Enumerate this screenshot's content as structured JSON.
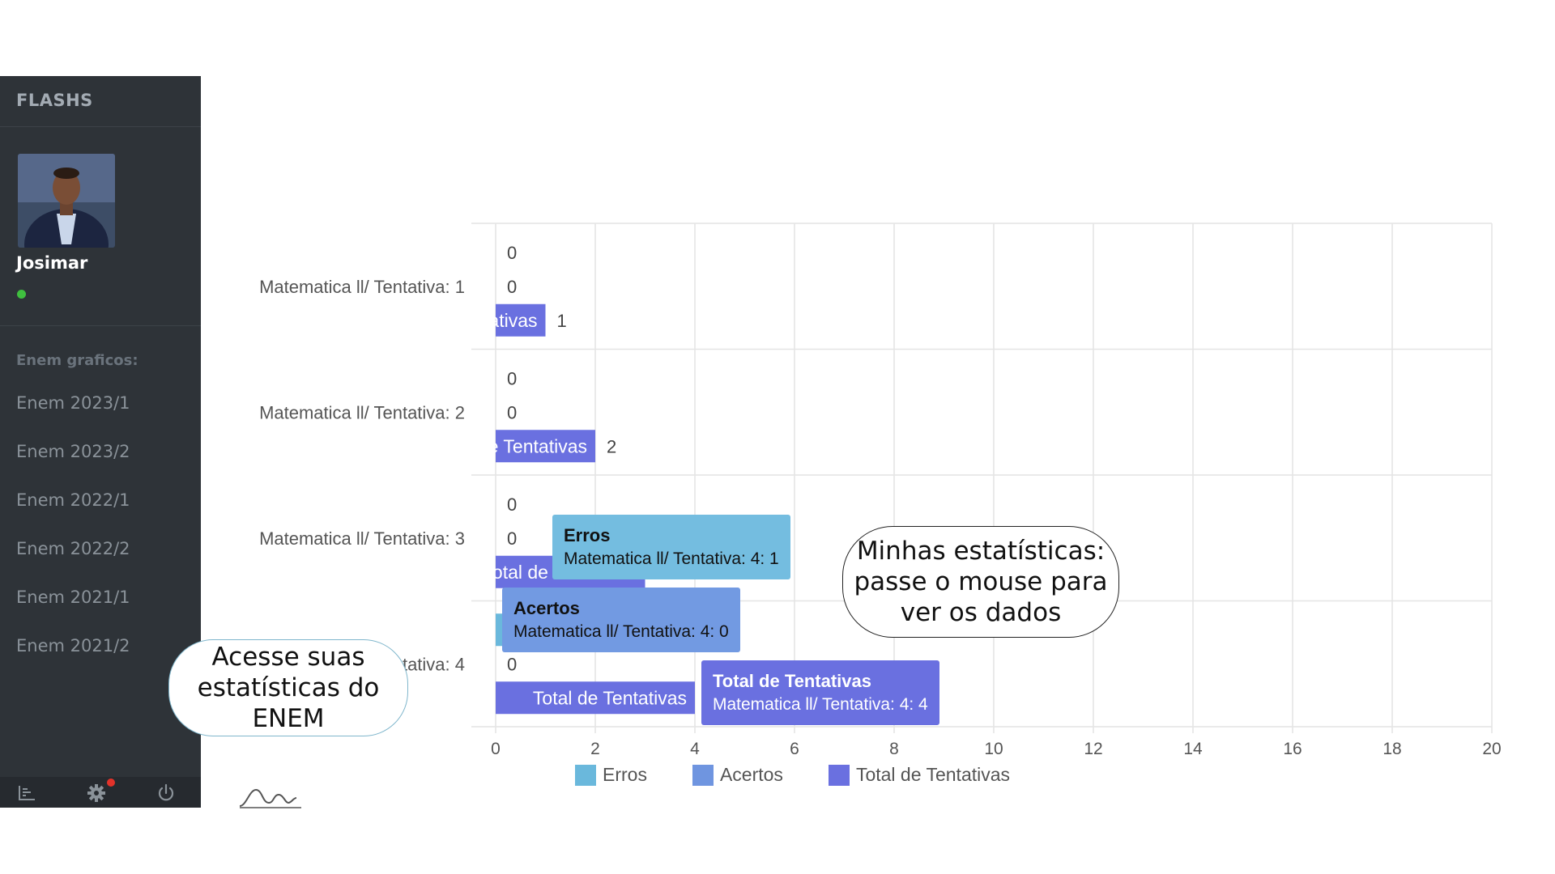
{
  "sidebar": {
    "brand": "FLASHS",
    "user": {
      "name": "Josimar",
      "status": "online"
    },
    "menu_header": "Enem graficos:",
    "menu_items": [
      "Enem 2023/1",
      "Enem 2023/2",
      "Enem 2022/1",
      "Enem 2022/2",
      "Enem 2021/1",
      "Enem 2021/2"
    ],
    "footer_icons": [
      "chart-bars-icon",
      "gear-icon",
      "power-icon"
    ]
  },
  "colors": {
    "erros": "#6ab8dc",
    "acertos": "#6f95e0",
    "total": "#6a70e0",
    "sidebar": "#2e3338"
  },
  "chart_data": {
    "type": "bar",
    "orientation": "horizontal",
    "categories": [
      "Matematica ll/ Tentativa: 1",
      "Matematica ll/ Tentativa: 2",
      "Matematica ll/ Tentativa: 3",
      "Matematica ll/ Tentativa: 4"
    ],
    "series": [
      {
        "name": "Erros",
        "values": [
          0,
          0,
          0,
          1
        ]
      },
      {
        "name": "Acertos",
        "values": [
          0,
          0,
          0,
          0
        ]
      },
      {
        "name": "Total de Tentativas",
        "values": [
          1,
          2,
          3,
          4
        ]
      }
    ],
    "xlim": [
      0,
      20
    ],
    "xticks": [
      0,
      2,
      4,
      6,
      8,
      10,
      12,
      14,
      16,
      18,
      20
    ],
    "grid": true,
    "legend": "bottom",
    "bar_label": "Total de Tentativas"
  },
  "tooltips": [
    {
      "title": "Erros",
      "body": "Matematica ll/ Tentativa: 4: 1"
    },
    {
      "title": "Acertos",
      "body": "Matematica ll/ Tentativa: 4: 0"
    },
    {
      "title": "Total de Tentativas",
      "body": "Matematica ll/ Tentativa: 4: 4"
    }
  ],
  "callouts": {
    "left": "Acesse suas estatísticas do ENEM",
    "right": "Minhas estatísticas: passe o mouse para ver os dados"
  }
}
